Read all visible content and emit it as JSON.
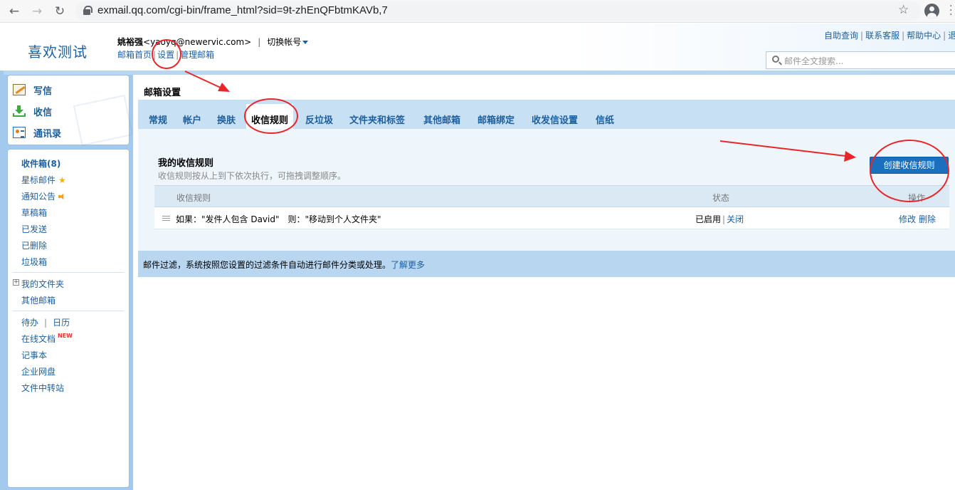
{
  "browser": {
    "url": "exmail.qq.com/cgi-bin/frame_html?sid=9t-zhEnQFbtmKAVb,7"
  },
  "header": {
    "logo": "喜欢测试",
    "user_name": "姚裕强",
    "user_email": "<yaoyq@newervic.com>",
    "separator": "|",
    "switch_account": "切换帐号",
    "links": [
      "邮箱首页",
      "设置",
      "管理邮箱"
    ],
    "top_right_links": [
      "自助查询",
      "联系客服",
      "帮助中心",
      "退"
    ],
    "search_placeholder": "邮件全文搜索..."
  },
  "sidebar": {
    "commands": [
      {
        "label": "写信",
        "icon": "compose-icon"
      },
      {
        "label": "收信",
        "icon": "inbox-download-icon"
      },
      {
        "label": "通讯录",
        "icon": "address-book-icon"
      }
    ],
    "folders": [
      {
        "label": "收件箱(8)"
      },
      {
        "label": "星标邮件"
      },
      {
        "label": "通知公告"
      },
      {
        "label": "草稿箱"
      },
      {
        "label": "已发送"
      },
      {
        "label": "已删除"
      },
      {
        "label": "垃圾箱"
      }
    ],
    "my_folders": "我的文件夹",
    "other_mailbox": "其他邮箱",
    "todo": "待办",
    "calendar": "日历",
    "online_docs": "在线文档",
    "online_docs_badge": "NEW",
    "notes": "记事本",
    "netdisk": "企业网盘",
    "transfer": "文件中转站"
  },
  "main": {
    "title": "邮箱设置",
    "tabs": [
      "常规",
      "帐户",
      "换肤",
      "收信规则",
      "反垃圾",
      "文件夹和标签",
      "其他邮箱",
      "邮箱绑定",
      "收发信设置",
      "信纸"
    ],
    "active_tab": "收信规则",
    "section_title": "我的收信规则",
    "section_desc": "收信规则按从上到下依次执行，可拖拽调整顺序。",
    "create_button": "创建收信规则",
    "table": {
      "headers": [
        "收信规则",
        "状态",
        "操作"
      ],
      "rows": [
        {
          "rule": "如果：\"发件人包含 David\"　则：\"移动到个人文件夹\"",
          "status": "已启用",
          "status_action": "关闭",
          "edit": "修改",
          "delete": "删除"
        }
      ]
    },
    "footer_text": "邮件过滤，系统按照您设置的过滤条件自动进行邮件分类或处理。",
    "footer_link": "了解更多"
  },
  "colors": {
    "brand_blue": "#1d5f9c",
    "frame_blue": "#a3c9ec",
    "button_blue": "#1a6fbf",
    "annotation_red": "#e8262a"
  }
}
